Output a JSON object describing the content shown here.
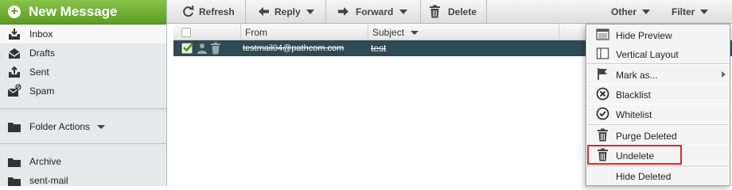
{
  "sidebar": {
    "new_message_label": "New Message",
    "folders": [
      {
        "label": "Inbox",
        "icon": "inbox-icon"
      },
      {
        "label": "Drafts",
        "icon": "drafts-icon"
      },
      {
        "label": "Sent",
        "icon": "sent-icon"
      },
      {
        "label": "Spam",
        "icon": "spam-icon"
      }
    ],
    "folder_actions_label": "Folder Actions",
    "bottom_folders": [
      {
        "label": "Archive",
        "icon": "folder-icon"
      },
      {
        "label": "sent-mail",
        "icon": "folder-icon"
      }
    ]
  },
  "toolbar": {
    "refresh_label": "Refresh",
    "reply_label": "Reply",
    "forward_label": "Forward",
    "delete_label": "Delete",
    "other_label": "Other",
    "filter_label": "Filter"
  },
  "list": {
    "columns": {
      "from": "From",
      "subject": "Subject"
    },
    "rows": [
      {
        "from": "testmail04@pathcom.com",
        "subject": "test",
        "selected": true,
        "deleted": true
      }
    ]
  },
  "menu": {
    "items": [
      {
        "label": "Hide Preview",
        "icon": "hide-preview-icon"
      },
      {
        "label": "Vertical Layout",
        "icon": "vertical-layout-icon"
      },
      {
        "label": "Mark as...",
        "icon": "flag-icon",
        "has_submenu": true
      },
      {
        "label": "Blacklist",
        "icon": "blacklist-icon"
      },
      {
        "label": "Whitelist",
        "icon": "whitelist-icon"
      },
      {
        "label": "Purge Deleted",
        "icon": "trash-icon"
      },
      {
        "label": "Undelete",
        "icon": "trash-icon",
        "highlighted": true
      },
      {
        "label": "Hide Deleted",
        "icon": ""
      }
    ]
  },
  "colors": {
    "new_message_green": "#6aa72e",
    "selected_row": "#2e4a53",
    "highlight_box": "#e0252b"
  }
}
